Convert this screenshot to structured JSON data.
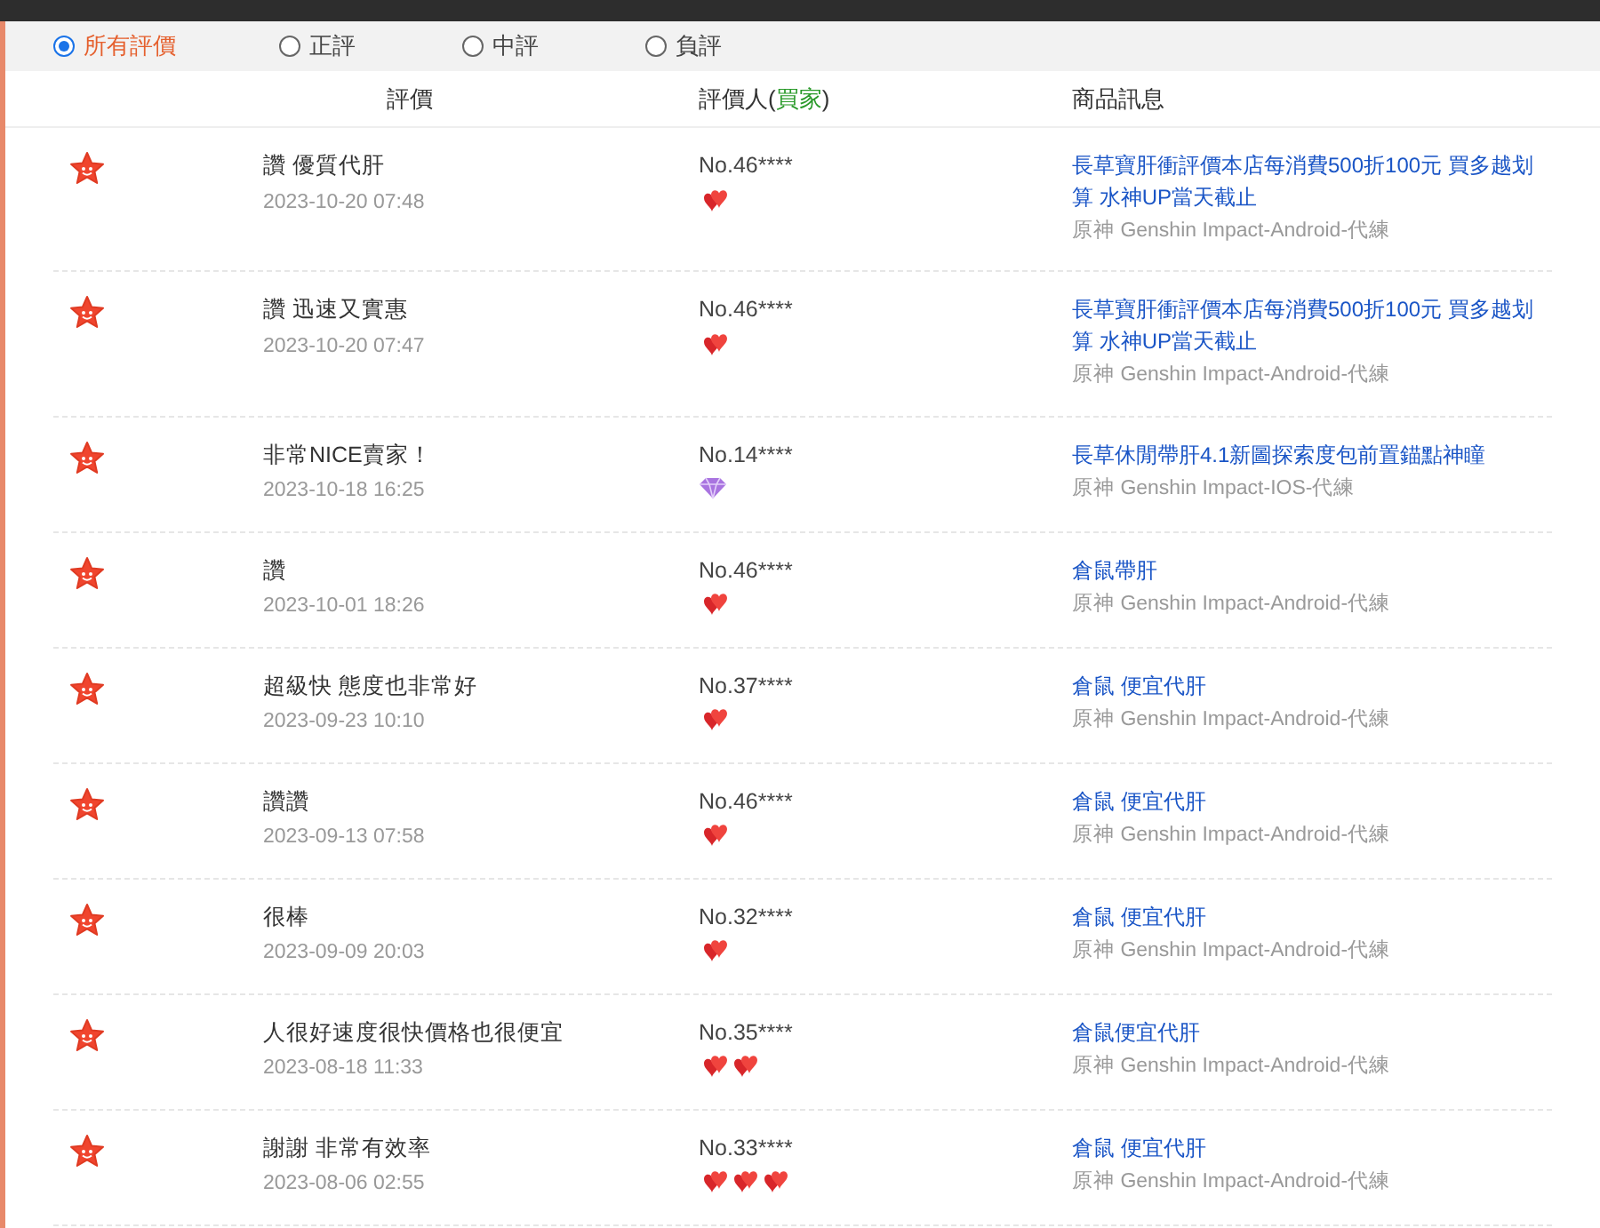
{
  "filters": [
    {
      "label": "所有評價",
      "selected": true
    },
    {
      "label": "正評",
      "selected": false
    },
    {
      "label": "中評",
      "selected": false
    },
    {
      "label": "負評",
      "selected": false
    }
  ],
  "columns": {
    "comment": "評價",
    "reviewer": [
      {
        "text": "評價人(",
        "highlight": false
      },
      {
        "text": "買家",
        "highlight": true
      },
      {
        "text": ")",
        "highlight": false
      }
    ],
    "product": "商品訊息"
  },
  "reviews": [
    {
      "comment": "讚 優質代肝",
      "time": "2023-10-20 07:48",
      "reviewer": "No.46****",
      "badges": [
        {
          "kind": "heart"
        }
      ],
      "product": "長草寶肝衝評價本店每消費500折100元 買多越划算 水神UP當天截止",
      "game": "原神 Genshin Impact-Android-代練"
    },
    {
      "comment": "讚 迅速又實惠",
      "time": "2023-10-20 07:47",
      "reviewer": "No.46****",
      "badges": [
        {
          "kind": "heart"
        }
      ],
      "product": "長草寶肝衝評價本店每消費500折100元 買多越划算 水神UP當天截止",
      "game": "原神 Genshin Impact-Android-代練"
    },
    {
      "comment": "非常NICE賣家！",
      "time": "2023-10-18 16:25",
      "reviewer": "No.14****",
      "badges": [
        {
          "kind": "diamond"
        }
      ],
      "product": "長草休閒帶肝4.1新圖探索度包前置錨點神瞳",
      "game": "原神 Genshin Impact-IOS-代練"
    },
    {
      "comment": "讚",
      "time": "2023-10-01 18:26",
      "reviewer": "No.46****",
      "badges": [
        {
          "kind": "heart"
        }
      ],
      "product": "倉鼠帶肝",
      "game": "原神 Genshin Impact-Android-代練"
    },
    {
      "comment": "超級快 態度也非常好",
      "time": "2023-09-23 10:10",
      "reviewer": "No.37****",
      "badges": [
        {
          "kind": "heart"
        }
      ],
      "product": "倉鼠 便宜代肝",
      "game": "原神 Genshin Impact-Android-代練"
    },
    {
      "comment": "讚讚",
      "time": "2023-09-13 07:58",
      "reviewer": "No.46****",
      "badges": [
        {
          "kind": "heart"
        }
      ],
      "product": "倉鼠 便宜代肝",
      "game": "原神 Genshin Impact-Android-代練"
    },
    {
      "comment": "很棒",
      "time": "2023-09-09 20:03",
      "reviewer": "No.32****",
      "badges": [
        {
          "kind": "heart"
        }
      ],
      "product": "倉鼠 便宜代肝",
      "game": "原神 Genshin Impact-Android-代練"
    },
    {
      "comment": "人很好速度很快價格也很便宜",
      "time": "2023-08-18 11:33",
      "reviewer": "No.35****",
      "badges": [
        {
          "kind": "heart"
        },
        {
          "kind": "heart"
        }
      ],
      "product": "倉鼠便宜代肝",
      "game": "原神 Genshin Impact-Android-代練"
    },
    {
      "comment": "謝謝 非常有效率",
      "time": "2023-08-06 02:55",
      "reviewer": "No.33****",
      "badges": [
        {
          "kind": "heart"
        },
        {
          "kind": "heart"
        },
        {
          "kind": "heart"
        }
      ],
      "product": "倉鼠 便宜代肝",
      "game": "原神 Genshin Impact-Android-代練"
    }
  ]
}
